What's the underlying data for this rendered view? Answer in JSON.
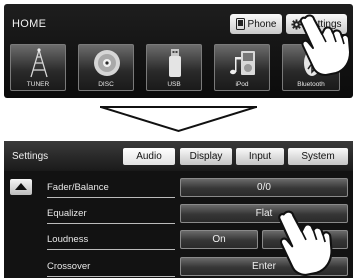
{
  "home": {
    "title": "HOME",
    "phone_label": "Phone",
    "settings_label": "Settings",
    "sources": [
      {
        "label": "TUNER",
        "icon": "antenna-tower-icon"
      },
      {
        "label": "DISC",
        "icon": "disc-icon"
      },
      {
        "label": "USB",
        "icon": "usb-icon"
      },
      {
        "label": "iPod",
        "icon": "music-player-icon"
      },
      {
        "label": "Bluetooth",
        "icon": "bluetooth-icon"
      }
    ]
  },
  "settings": {
    "title": "Settings",
    "tabs": [
      "Audio",
      "Display",
      "Input",
      "System"
    ],
    "active_tab": "Audio",
    "rows": [
      {
        "label": "Fader/Balance",
        "value": "0/0"
      },
      {
        "label": "Equalizer",
        "value": "Flat"
      },
      {
        "label": "Loudness",
        "value": "On"
      },
      {
        "label": "Crossover",
        "value": "Enter"
      }
    ]
  }
}
